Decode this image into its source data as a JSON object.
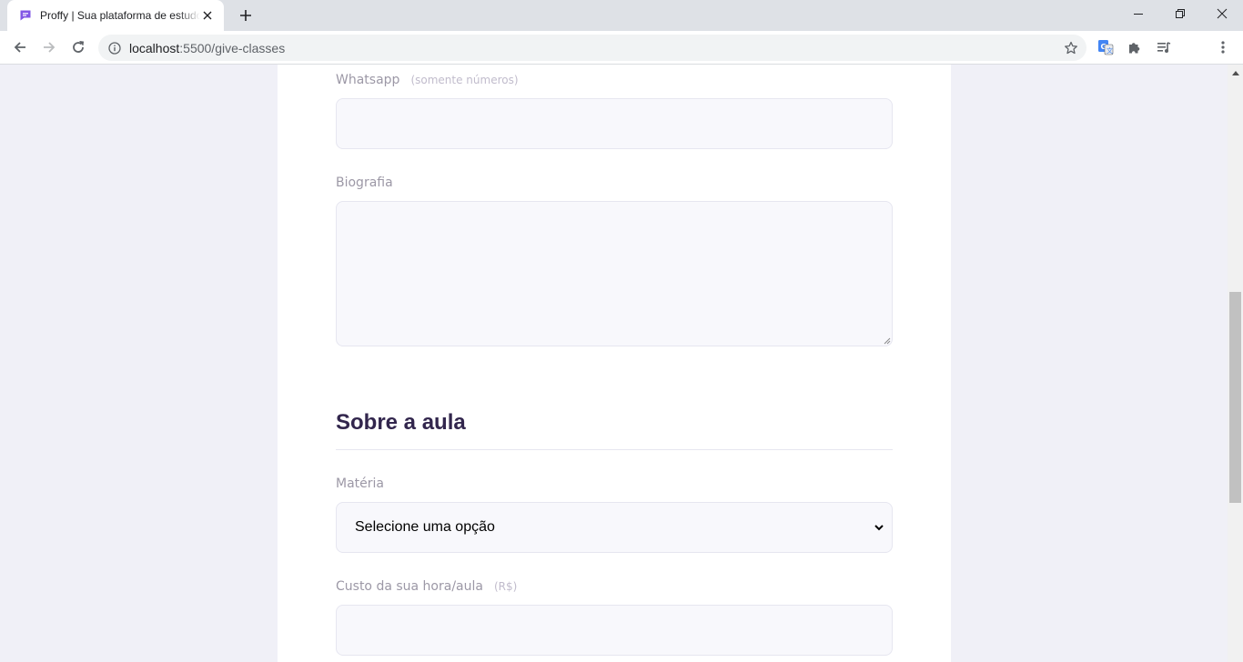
{
  "browser": {
    "tab": {
      "title": "Proffy | Sua plataforma de estudos",
      "favicon": "proffy-chat-icon",
      "favicon_color": "#8257e5"
    },
    "address_bar": {
      "host": "localhost",
      "path": ":5500/give-classes"
    },
    "icons": {
      "back": "back-arrow-icon",
      "forward": "forward-arrow-icon",
      "reload": "reload-icon",
      "info": "info-icon",
      "bookmark": "star-icon",
      "translate": "google-translate-icon",
      "extensions": "puzzle-icon",
      "reading_list": "media-queue-icon",
      "menu": "kebab-menu-icon"
    }
  },
  "form": {
    "whatsapp": {
      "label": "Whatsapp",
      "hint": "(somente números)",
      "value": ""
    },
    "bio": {
      "label": "Biografia",
      "value": ""
    },
    "section": {
      "title": "Sobre a aula"
    },
    "subject": {
      "label": "Matéria",
      "selected": "Selecione uma opção"
    },
    "cost": {
      "label": "Custo da sua hora/aula",
      "hint": "(R$)",
      "value": ""
    }
  },
  "colors": {
    "page_background": "#f0f0f7",
    "card_background": "#ffffff",
    "label": "#9c98a6",
    "hint": "#c1bccc",
    "title": "#32264d",
    "input_background": "#f8f8fc",
    "input_border": "#e6e6f0"
  }
}
